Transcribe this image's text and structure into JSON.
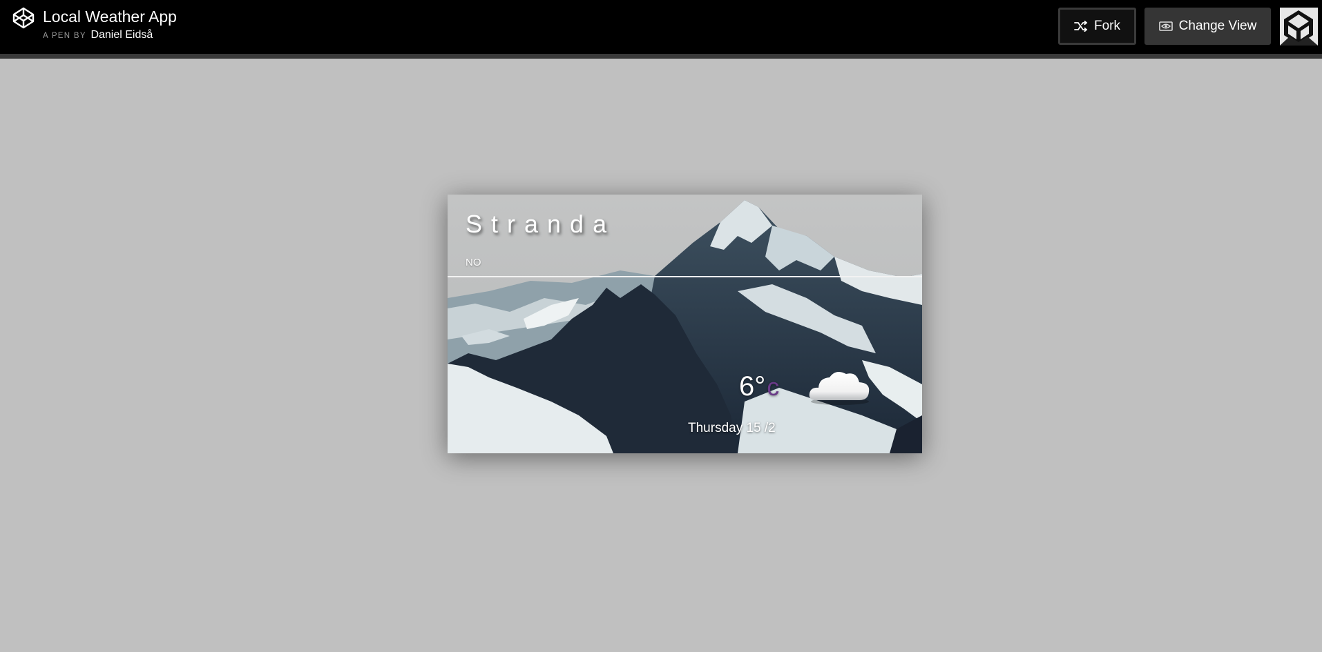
{
  "header": {
    "app_title": "Local Weather App",
    "pen_by_label": "A PEN BY",
    "author": "Daniel Eidså",
    "fork_label": "Fork",
    "change_view_label": "Change View",
    "icons": {
      "logo": "codepen-logo-icon",
      "fork": "fork-icon",
      "change_view": "eye-icon",
      "avatar": "user-avatar"
    }
  },
  "weather": {
    "city": "Stranda",
    "country": "NO",
    "temperature": "6°",
    "unit": "c",
    "date": "Thursday 15 /2",
    "condition_icon": "cloud-icon"
  },
  "colors": {
    "page_background": "#c0c0c0",
    "header_background": "#000000",
    "unit_accent": "#6a3a88"
  }
}
